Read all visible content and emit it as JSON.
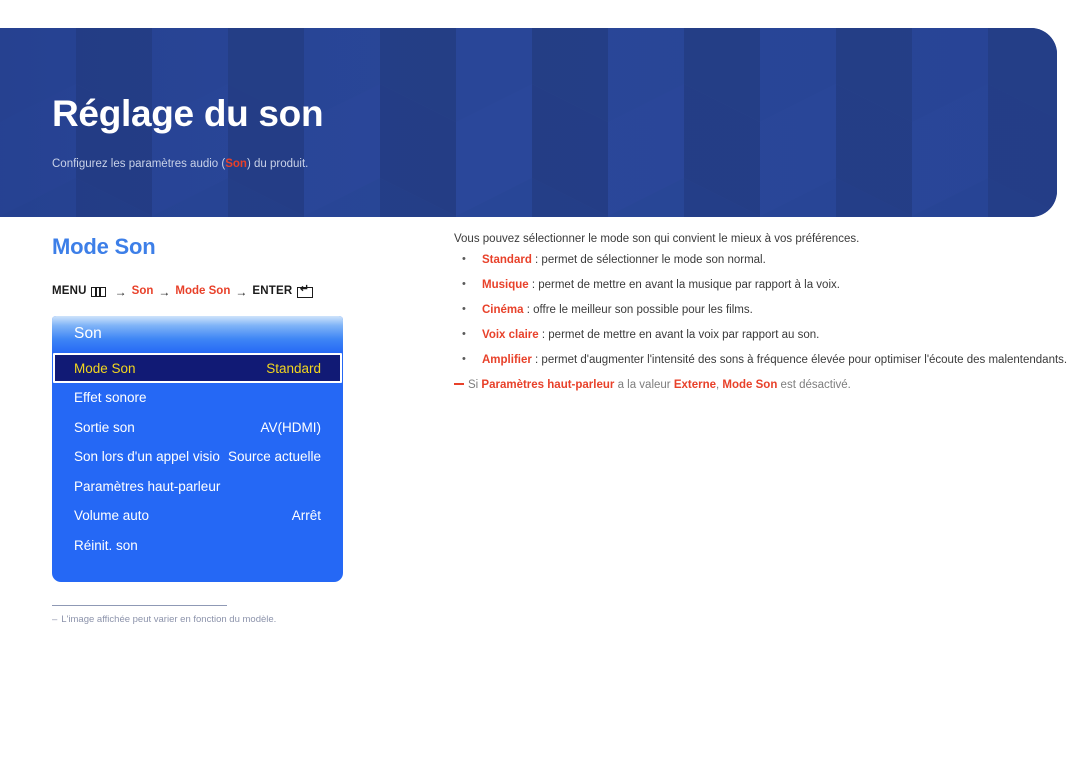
{
  "banner": {
    "title": "Réglage du son",
    "subtitle_before": "Configurez les paramètres audio (",
    "subtitle_highlight": "Son",
    "subtitle_after": ") du produit."
  },
  "section": {
    "title": "Mode Son"
  },
  "menu_path": {
    "menu_label": "MENU",
    "menu_icon": "menu-grid-icon",
    "arrow": "→",
    "step1": "Son",
    "step2": "Mode Son",
    "enter_label": "ENTER",
    "enter_icon": "enter-return-icon"
  },
  "osd": {
    "header": "Son",
    "rows": [
      {
        "label": "Mode Son",
        "value": "Standard",
        "selected": true
      },
      {
        "label": "Effet sonore",
        "value": "",
        "selected": false
      },
      {
        "label": "Sortie son",
        "value": "AV(HDMI)",
        "selected": false
      },
      {
        "label": "Son lors d'un appel visio",
        "value": "Source actuelle",
        "selected": false
      },
      {
        "label": "Paramètres haut-parleur",
        "value": "",
        "selected": false
      },
      {
        "label": "Volume auto",
        "value": "Arrêt",
        "selected": false
      },
      {
        "label": "Réinit. son",
        "value": "",
        "selected": false
      }
    ]
  },
  "footnote": {
    "dash": "–",
    "text": "L'image affichée peut varier en fonction du modèle."
  },
  "description": {
    "intro": "Vous pouvez sélectionner le mode son qui convient le mieux à vos préférences.",
    "bullets": [
      {
        "term": "Standard",
        "text": " : permet de sélectionner le mode son normal."
      },
      {
        "term": "Musique",
        "text": " : permet de mettre en avant la musique par rapport à la voix."
      },
      {
        "term": "Cinéma",
        "text": " : offre le meilleur son possible pour les films."
      },
      {
        "term": "Voix claire",
        "text": " : permet de mettre en avant la voix par rapport au son."
      },
      {
        "term": "Amplifier",
        "text": " : permet d'augmenter l'intensité des sons à fréquence élevée pour optimiser l'écoute des malentendants."
      }
    ],
    "note": {
      "part1": "Si ",
      "term1": "Paramètres haut-parleur",
      "part2": " a la valeur ",
      "term2": "Externe",
      "part3": ", ",
      "term3": "Mode Son",
      "part4": " est désactivé."
    }
  },
  "colors": {
    "banner_bg": "#27428f",
    "accent_blue": "#3d7fe8",
    "accent_orange": "#e8412a",
    "osd_bg": "#2568f5",
    "osd_selected_bg": "#111a75",
    "osd_selected_text": "#f2d61e"
  }
}
